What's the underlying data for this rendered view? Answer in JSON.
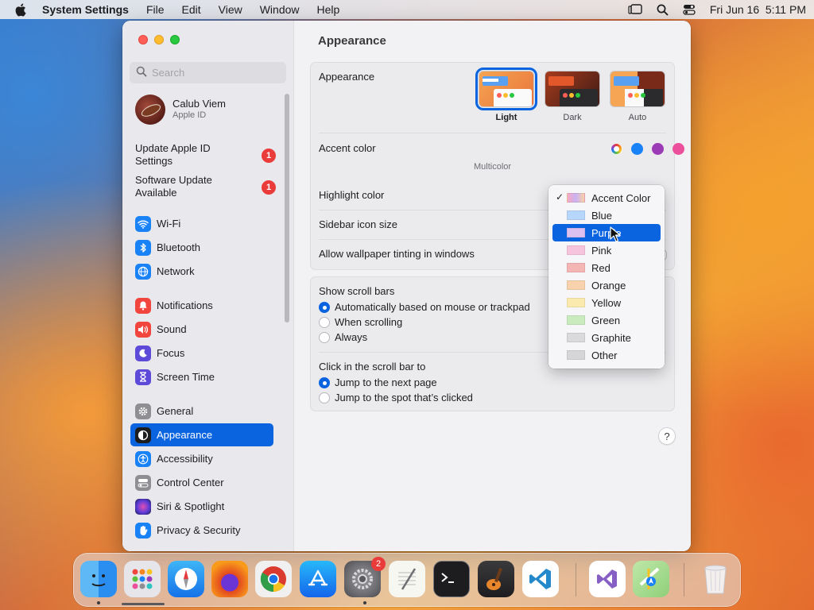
{
  "menubar": {
    "app_name": "System Settings",
    "menus": [
      "File",
      "Edit",
      "View",
      "Window",
      "Help"
    ],
    "clock": "Fri Jun 16  5:11 PM"
  },
  "sidebar": {
    "search_placeholder": "Search",
    "profile": {
      "name": "Calub Viem",
      "subtitle": "Apple ID"
    },
    "notices": [
      {
        "label": "Update Apple ID Settings",
        "badge": "1"
      },
      {
        "label": "Software Update Available",
        "badge": "1"
      }
    ],
    "items": [
      {
        "label": "Wi-Fi",
        "icon": "wifi-icon",
        "color": "#1a82f7"
      },
      {
        "label": "Bluetooth",
        "icon": "bluetooth-icon",
        "color": "#1a82f7"
      },
      {
        "label": "Network",
        "icon": "globe-icon",
        "color": "#1a82f7"
      },
      {
        "label": "Notifications",
        "icon": "bell-icon",
        "color": "#f1453d"
      },
      {
        "label": "Sound",
        "icon": "speaker-icon",
        "color": "#f1453d"
      },
      {
        "label": "Focus",
        "icon": "moon-icon",
        "color": "#5d4ad8"
      },
      {
        "label": "Screen Time",
        "icon": "hourglass-icon",
        "color": "#5d4ad8"
      },
      {
        "label": "General",
        "icon": "gear-icon",
        "color": "#8e8e93"
      },
      {
        "label": "Appearance",
        "icon": "appearance-icon",
        "color": "#1d1d1f"
      },
      {
        "label": "Accessibility",
        "icon": "accessibility-icon",
        "color": "#1a82f7"
      },
      {
        "label": "Control Center",
        "icon": "toggles-icon",
        "color": "#8e8e93"
      },
      {
        "label": "Siri & Spotlight",
        "icon": "siri-icon",
        "color": "#2a2a5e"
      },
      {
        "label": "Privacy & Security",
        "icon": "hand-icon",
        "color": "#1a82f7"
      }
    ],
    "active_item": "Appearance"
  },
  "main": {
    "title": "Appearance",
    "appearance": {
      "label": "Appearance",
      "options": [
        "Light",
        "Dark",
        "Auto"
      ],
      "selected": "Light"
    },
    "accent": {
      "label": "Accent color",
      "caption": "Multicolor",
      "colors": [
        "#1a82f7",
        "#9b3bb5",
        "#ec4f9c",
        "#e5393b",
        "#f3861f",
        "#f8c322",
        "#5bbf3e",
        "#8e8e93"
      ]
    },
    "rows": {
      "highlight": "Highlight color",
      "sidebar_icon_size": "Sidebar icon size",
      "wallpaper_tinting": "Allow wallpaper tinting in windows"
    },
    "scroll_bars": {
      "label": "Show scroll bars",
      "options": [
        "Automatically based on mouse or trackpad",
        "When scrolling",
        "Always"
      ],
      "selected": 0
    },
    "click_scroll": {
      "label": "Click in the scroll bar to",
      "options": [
        "Jump to the next page",
        "Jump to the spot that’s clicked"
      ],
      "selected": 0
    },
    "help": "?"
  },
  "highlight_menu": {
    "items": [
      {
        "label": "Accent Color",
        "color": "#e6a6c6",
        "checked": true
      },
      {
        "label": "Blue",
        "color": "#b7d6fb"
      },
      {
        "label": "Purple",
        "color": "#dcc1f0"
      },
      {
        "label": "Pink",
        "color": "#f7c4dd"
      },
      {
        "label": "Red",
        "color": "#f4b6b5"
      },
      {
        "label": "Orange",
        "color": "#f8d2ad"
      },
      {
        "label": "Yellow",
        "color": "#fbeaae"
      },
      {
        "label": "Green",
        "color": "#c9ebbd"
      },
      {
        "label": "Graphite",
        "color": "#dadadd"
      },
      {
        "label": "Other",
        "color": "#d6d6d8"
      }
    ],
    "highlighted": "Purple"
  },
  "dock": {
    "apps": [
      "finder-icon",
      "launchpad-icon",
      "safari-icon",
      "firefox-icon",
      "chrome-icon",
      "app-store-icon",
      "system-settings-icon",
      "textedit-icon",
      "terminal-icon",
      "garageband-icon",
      "vscode-icon",
      "visual-studio-icon",
      "maps-icon",
      "trash-icon"
    ],
    "settings_badge": "2"
  }
}
